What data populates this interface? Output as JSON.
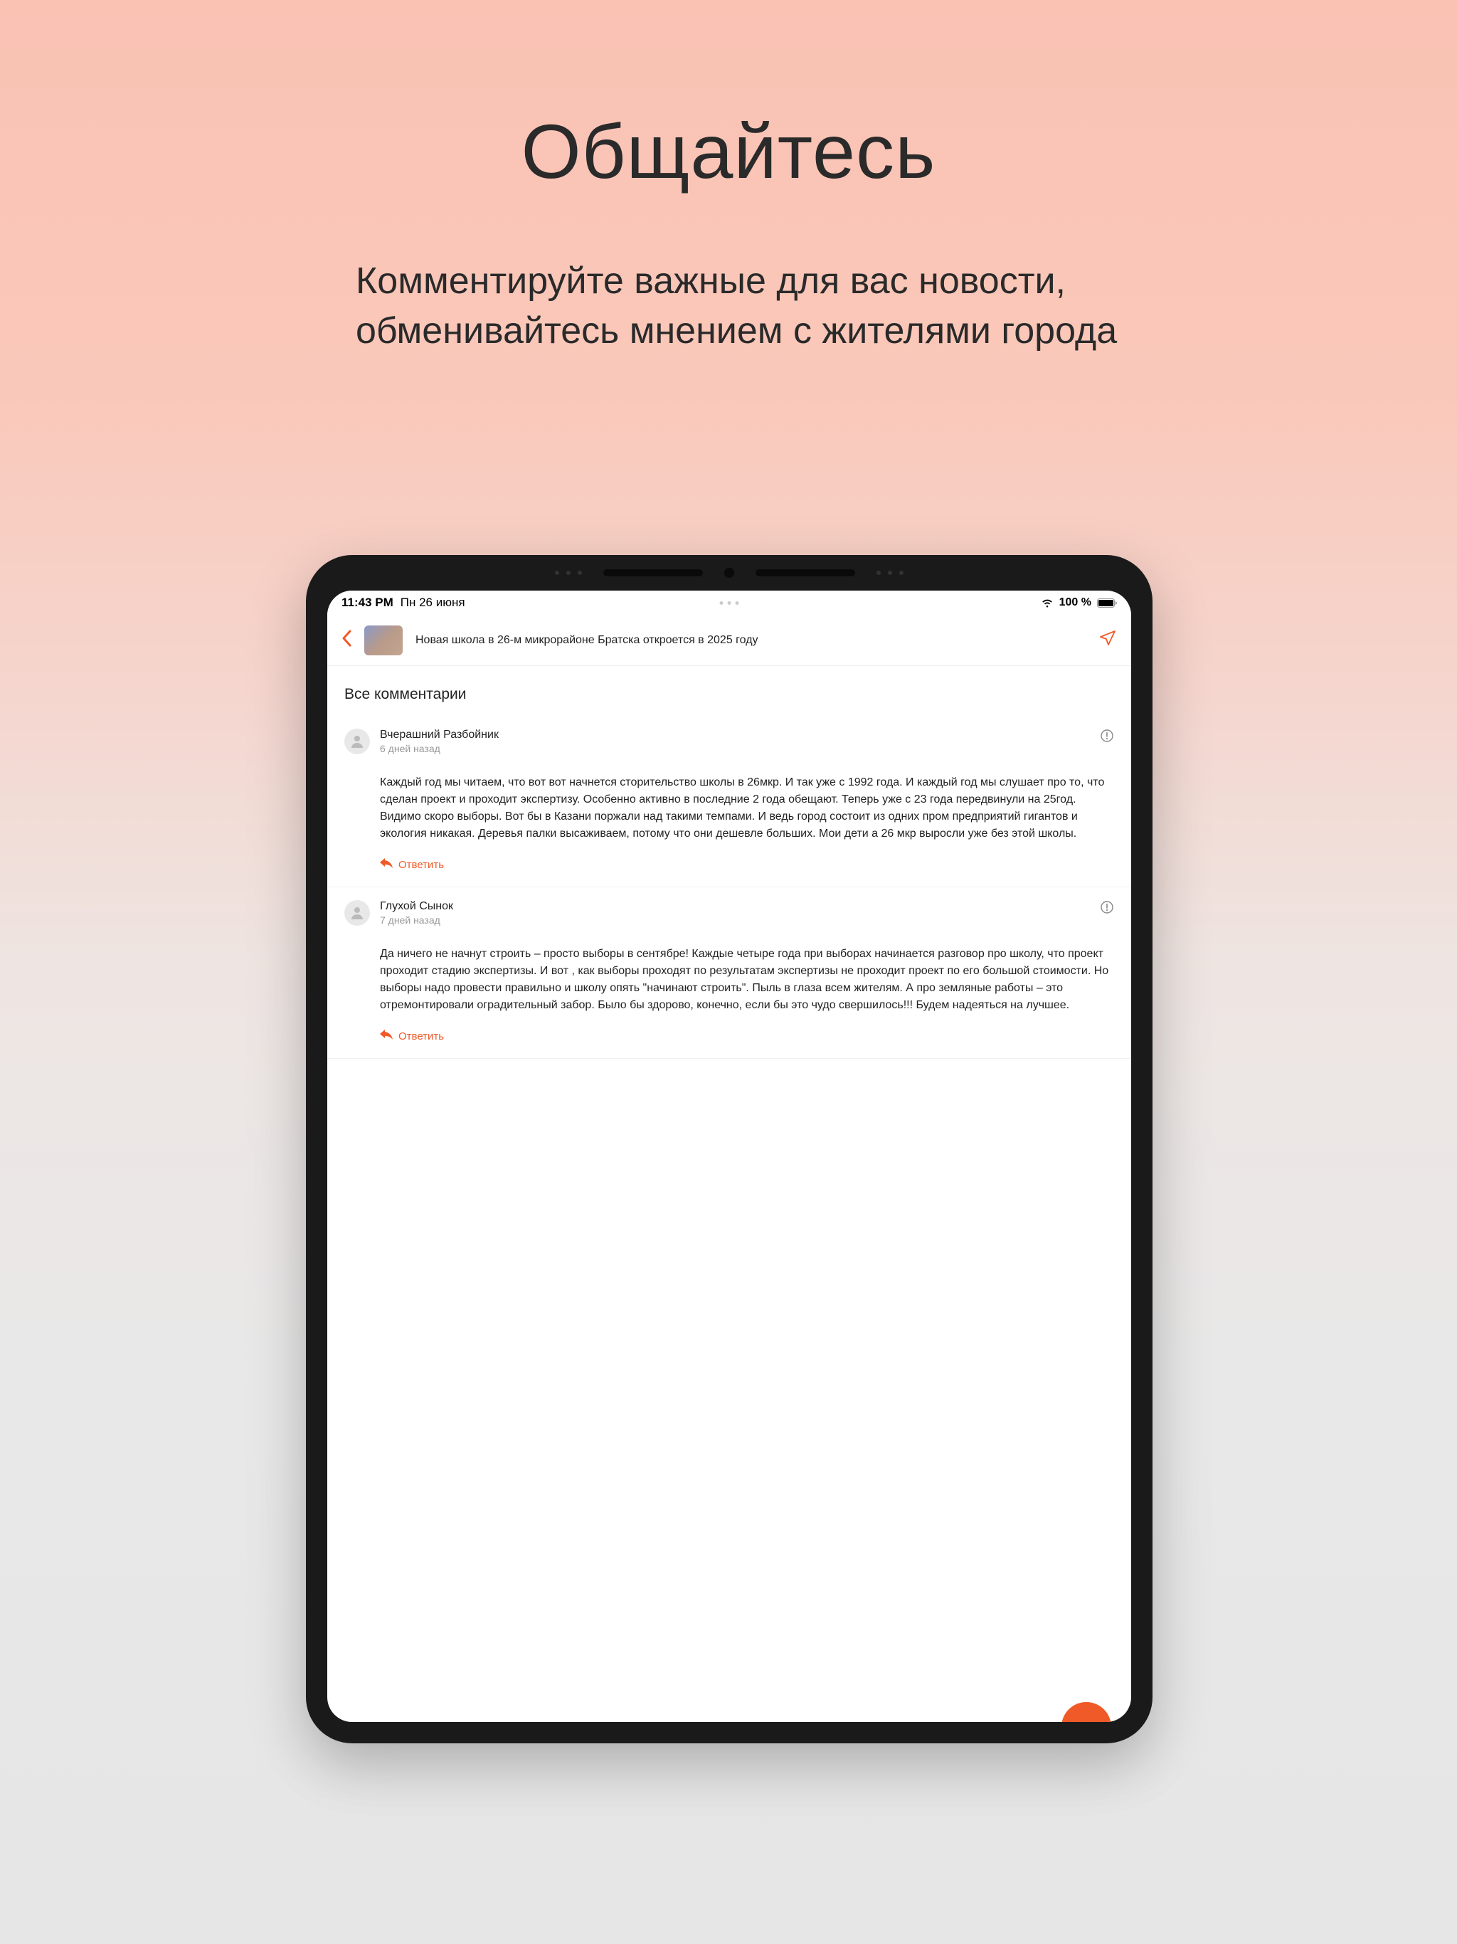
{
  "promo": {
    "title": "Общайтесь",
    "subtitle": "Комментируйте важные для вас новости, обменивайтесь мнением с жителями города"
  },
  "status_bar": {
    "time": "11:43 PM",
    "date": "Пн 26 июня",
    "battery_label": "100 %"
  },
  "article": {
    "title": "Новая школа в 26-м микрорайоне Братска откроется в 2025 году"
  },
  "comments_section": {
    "title": "Все комментарии"
  },
  "comments": [
    {
      "author": "Вчерашний Разбойник",
      "time": "6 дней назад",
      "body": "Каждый год мы читаем, что вот вот начнется сторительство школы в 26мкр. И так уже с 1992 года. И каждый год мы слушает про то, что сделан проект и проходит экспертизу. Особенно активно в последние 2 года обещают. Теперь уже с 23 года передвинули на 25год. Видимо скоро выборы. Вот бы в Казани поржали над такими темпами. И ведь город состоит из одних пром предприятий гигантов и экология никакая. Деревья палки высаживаем, потому что они дешевле больших. Мои дети а 26 мкр выросли уже без этой школы.",
      "reply_label": "Ответить"
    },
    {
      "author": "Глухой Сынок",
      "time": "7 дней назад",
      "body": "Да ничего не начнут строить – просто выборы в сентябре! Каждые четыре года при выборах начинается разговор про школу, что проект проходит стадию экспертизы. И вот , как выборы проходят по результатам экспертизы не проходит проект по его большой стоимости. Но выборы надо провести правильно и школу опять \"начинают строить\". Пыль в глаза всем жителям. А про земляные работы – это отремонтировали оградительный забор. Было бы здорово, конечно, если бы это чудо свершилось!!! Будем надеяться на лучшее.",
      "reply_label": "Ответить"
    }
  ]
}
